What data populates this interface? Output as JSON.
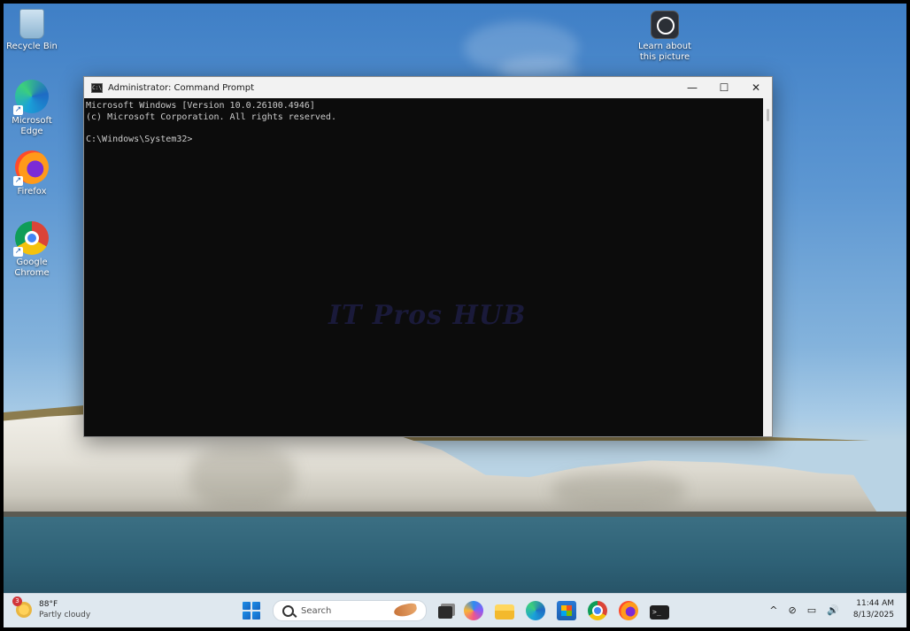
{
  "desktop": {
    "icons": [
      {
        "label": "Recycle Bin",
        "icon": "recycle-bin-icon"
      },
      {
        "label": "Microsoft Edge",
        "icon": "edge-icon"
      },
      {
        "label": "Firefox",
        "icon": "firefox-icon"
      },
      {
        "label": "Google Chrome",
        "icon": "chrome-icon"
      }
    ],
    "learn": {
      "line1": "Learn about",
      "line2": "this picture",
      "icon": "learn-picture-icon"
    }
  },
  "window": {
    "title": "Administrator: Command Prompt",
    "app_icon_text": "C:\\",
    "controls": {
      "minimize": "—",
      "maximize": "☐",
      "close": "✕"
    },
    "lines": [
      "Microsoft Windows [Version 10.0.26100.4946]",
      "(c) Microsoft Corporation. All rights reserved.",
      "",
      "C:\\Windows\\System32>"
    ],
    "watermark": "IT Pros HUB"
  },
  "taskbar": {
    "weather": {
      "badge": "3",
      "temp": "88°F",
      "condition": "Partly cloudy"
    },
    "search_placeholder": "Search",
    "apps": [
      "task-view-icon",
      "copilot-icon",
      "file-explorer-icon",
      "edge-icon",
      "store-icon",
      "chrome-icon",
      "firefox-icon",
      "terminal-icon"
    ],
    "terminal_glyph": ">_",
    "tray": {
      "chevron": "^",
      "network": "⊘",
      "display": "▭",
      "volume": "🔊"
    },
    "clock": {
      "time": "11:44 AM",
      "date": "8/13/2025"
    }
  },
  "colors": {
    "terminal_bg": "#0c0c0c",
    "terminal_fg": "#cccccc",
    "titlebar": "#f2f2f2",
    "taskbar": "#dfe8ef"
  }
}
